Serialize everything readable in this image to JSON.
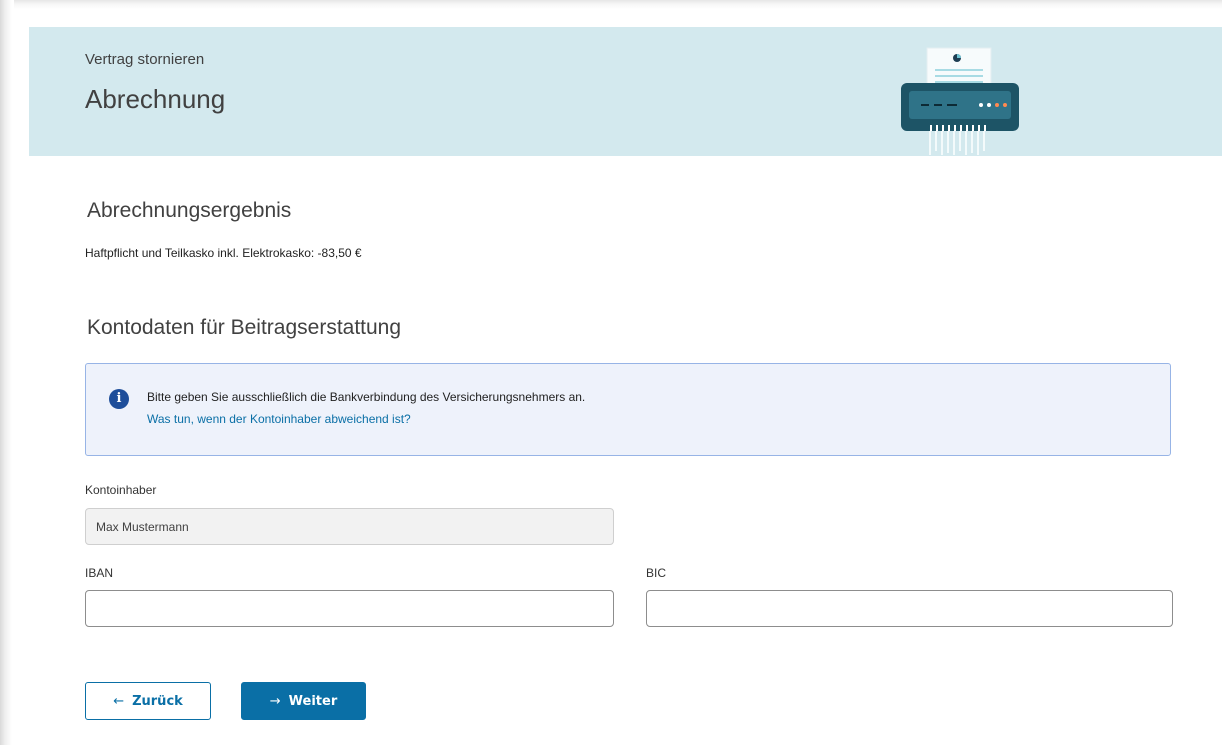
{
  "header": {
    "kicker": "Vertrag stornieren",
    "title": "Abrechnung"
  },
  "result": {
    "heading": "Abrechnungsergebnis",
    "line": "Haftpflicht und Teilkasko inkl. Elektrokasko: -83,50 €"
  },
  "account": {
    "heading": "Kontodaten für Beitragserstattung",
    "info_text": "Bitte geben Sie ausschließlich die Bankverbindung des Versicherungsnehmers an.",
    "info_link": "Was tun, wenn der Kontoinhaber abweichend ist?",
    "holder_label": "Kontoinhaber",
    "holder_value": "Max Mustermann",
    "iban_label": "IBAN",
    "iban_value": "",
    "bic_label": "BIC",
    "bic_value": ""
  },
  "buttons": {
    "back_label": "Zurück",
    "next_label": "Weiter",
    "back_arrow": "←",
    "next_arrow": "→"
  },
  "icons": {
    "info": "info-icon",
    "shredder": "shredder-illustration"
  },
  "colors": {
    "header_bg": "#d3e9ee",
    "accent": "#0a6fa6",
    "info_bg": "#eef2fb",
    "info_border": "#97b4e6"
  }
}
